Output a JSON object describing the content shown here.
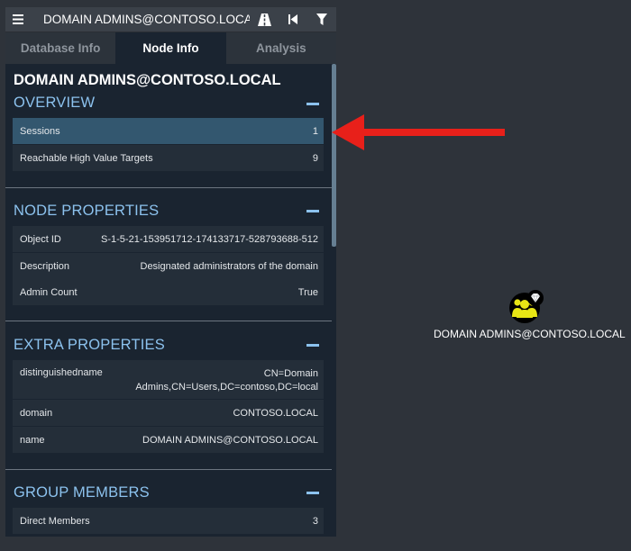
{
  "search": {
    "value": "DOMAIN ADMINS@CONTOSO.LOCAL"
  },
  "tabs": [
    {
      "label": "Database Info"
    },
    {
      "label": "Node Info"
    },
    {
      "label": "Analysis"
    }
  ],
  "node": {
    "title": "DOMAIN ADMINS@CONTOSO.LOCAL"
  },
  "overview": {
    "title": "OVERVIEW",
    "rows": [
      {
        "label": "Sessions",
        "value": "1"
      },
      {
        "label": "Reachable High Value Targets",
        "value": "9"
      }
    ]
  },
  "node_properties": {
    "title": "NODE PROPERTIES",
    "rows": [
      {
        "label": "Object ID",
        "value": "S-1-5-21-153951712-174133717-528793688-512"
      },
      {
        "label": "Description",
        "value": "Designated administrators of the domain"
      },
      {
        "label": "Admin Count",
        "value": "True"
      }
    ]
  },
  "extra_properties": {
    "title": "EXTRA PROPERTIES",
    "rows": [
      {
        "label": "distinguishedname",
        "value_line1": "CN=Domain",
        "value_line2": "Admins,CN=Users,DC=contoso,DC=local"
      },
      {
        "label": "domain",
        "value": "CONTOSO.LOCAL"
      },
      {
        "label": "name",
        "value": "DOMAIN ADMINS@CONTOSO.LOCAL"
      }
    ]
  },
  "group_members": {
    "title": "GROUP MEMBERS",
    "rows": [
      {
        "label": "Direct Members",
        "value": "3"
      }
    ]
  },
  "graph": {
    "node_label": "DOMAIN ADMINS@CONTOSO.LOCAL"
  },
  "colors": {
    "background": "#2e333a",
    "panel": "#1a2430",
    "section_header": "#8cc2ee",
    "highlight_row": "#33576f",
    "arrow": "#e8201a",
    "group_node": "#e8e615"
  },
  "icons": [
    "menu-icon",
    "road-icon",
    "back-icon",
    "filter-icon",
    "group-icon",
    "gem-icon",
    "arrow-icon"
  ]
}
